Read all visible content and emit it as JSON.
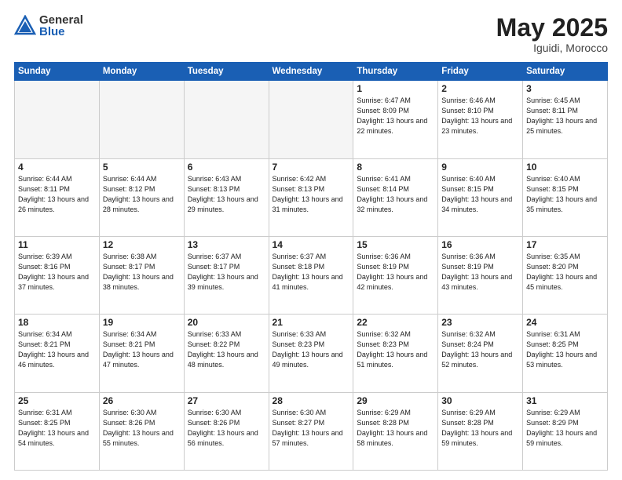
{
  "header": {
    "logo_general": "General",
    "logo_blue": "Blue",
    "title": "May 2025",
    "location": "Iguidi, Morocco"
  },
  "days_of_week": [
    "Sunday",
    "Monday",
    "Tuesday",
    "Wednesday",
    "Thursday",
    "Friday",
    "Saturday"
  ],
  "weeks": [
    [
      {
        "num": "",
        "empty": true
      },
      {
        "num": "",
        "empty": true
      },
      {
        "num": "",
        "empty": true
      },
      {
        "num": "",
        "empty": true
      },
      {
        "num": "1",
        "rise": "6:47 AM",
        "set": "8:09 PM",
        "hours": "13 hours and 22 minutes."
      },
      {
        "num": "2",
        "rise": "6:46 AM",
        "set": "8:10 PM",
        "hours": "13 hours and 23 minutes."
      },
      {
        "num": "3",
        "rise": "6:45 AM",
        "set": "8:11 PM",
        "hours": "13 hours and 25 minutes."
      }
    ],
    [
      {
        "num": "4",
        "rise": "6:44 AM",
        "set": "8:11 PM",
        "hours": "13 hours and 26 minutes."
      },
      {
        "num": "5",
        "rise": "6:44 AM",
        "set": "8:12 PM",
        "hours": "13 hours and 28 minutes."
      },
      {
        "num": "6",
        "rise": "6:43 AM",
        "set": "8:13 PM",
        "hours": "13 hours and 29 minutes."
      },
      {
        "num": "7",
        "rise": "6:42 AM",
        "set": "8:13 PM",
        "hours": "13 hours and 31 minutes."
      },
      {
        "num": "8",
        "rise": "6:41 AM",
        "set": "8:14 PM",
        "hours": "13 hours and 32 minutes."
      },
      {
        "num": "9",
        "rise": "6:40 AM",
        "set": "8:15 PM",
        "hours": "13 hours and 34 minutes."
      },
      {
        "num": "10",
        "rise": "6:40 AM",
        "set": "8:15 PM",
        "hours": "13 hours and 35 minutes."
      }
    ],
    [
      {
        "num": "11",
        "rise": "6:39 AM",
        "set": "8:16 PM",
        "hours": "13 hours and 37 minutes."
      },
      {
        "num": "12",
        "rise": "6:38 AM",
        "set": "8:17 PM",
        "hours": "13 hours and 38 minutes."
      },
      {
        "num": "13",
        "rise": "6:37 AM",
        "set": "8:17 PM",
        "hours": "13 hours and 39 minutes."
      },
      {
        "num": "14",
        "rise": "6:37 AM",
        "set": "8:18 PM",
        "hours": "13 hours and 41 minutes."
      },
      {
        "num": "15",
        "rise": "6:36 AM",
        "set": "8:19 PM",
        "hours": "13 hours and 42 minutes."
      },
      {
        "num": "16",
        "rise": "6:36 AM",
        "set": "8:19 PM",
        "hours": "13 hours and 43 minutes."
      },
      {
        "num": "17",
        "rise": "6:35 AM",
        "set": "8:20 PM",
        "hours": "13 hours and 45 minutes."
      }
    ],
    [
      {
        "num": "18",
        "rise": "6:34 AM",
        "set": "8:21 PM",
        "hours": "13 hours and 46 minutes."
      },
      {
        "num": "19",
        "rise": "6:34 AM",
        "set": "8:21 PM",
        "hours": "13 hours and 47 minutes."
      },
      {
        "num": "20",
        "rise": "6:33 AM",
        "set": "8:22 PM",
        "hours": "13 hours and 48 minutes."
      },
      {
        "num": "21",
        "rise": "6:33 AM",
        "set": "8:23 PM",
        "hours": "13 hours and 49 minutes."
      },
      {
        "num": "22",
        "rise": "6:32 AM",
        "set": "8:23 PM",
        "hours": "13 hours and 51 minutes."
      },
      {
        "num": "23",
        "rise": "6:32 AM",
        "set": "8:24 PM",
        "hours": "13 hours and 52 minutes."
      },
      {
        "num": "24",
        "rise": "6:31 AM",
        "set": "8:25 PM",
        "hours": "13 hours and 53 minutes."
      }
    ],
    [
      {
        "num": "25",
        "rise": "6:31 AM",
        "set": "8:25 PM",
        "hours": "13 hours and 54 minutes."
      },
      {
        "num": "26",
        "rise": "6:30 AM",
        "set": "8:26 PM",
        "hours": "13 hours and 55 minutes."
      },
      {
        "num": "27",
        "rise": "6:30 AM",
        "set": "8:26 PM",
        "hours": "13 hours and 56 minutes."
      },
      {
        "num": "28",
        "rise": "6:30 AM",
        "set": "8:27 PM",
        "hours": "13 hours and 57 minutes."
      },
      {
        "num": "29",
        "rise": "6:29 AM",
        "set": "8:28 PM",
        "hours": "13 hours and 58 minutes."
      },
      {
        "num": "30",
        "rise": "6:29 AM",
        "set": "8:28 PM",
        "hours": "13 hours and 59 minutes."
      },
      {
        "num": "31",
        "rise": "6:29 AM",
        "set": "8:29 PM",
        "hours": "13 hours and 59 minutes."
      }
    ]
  ]
}
